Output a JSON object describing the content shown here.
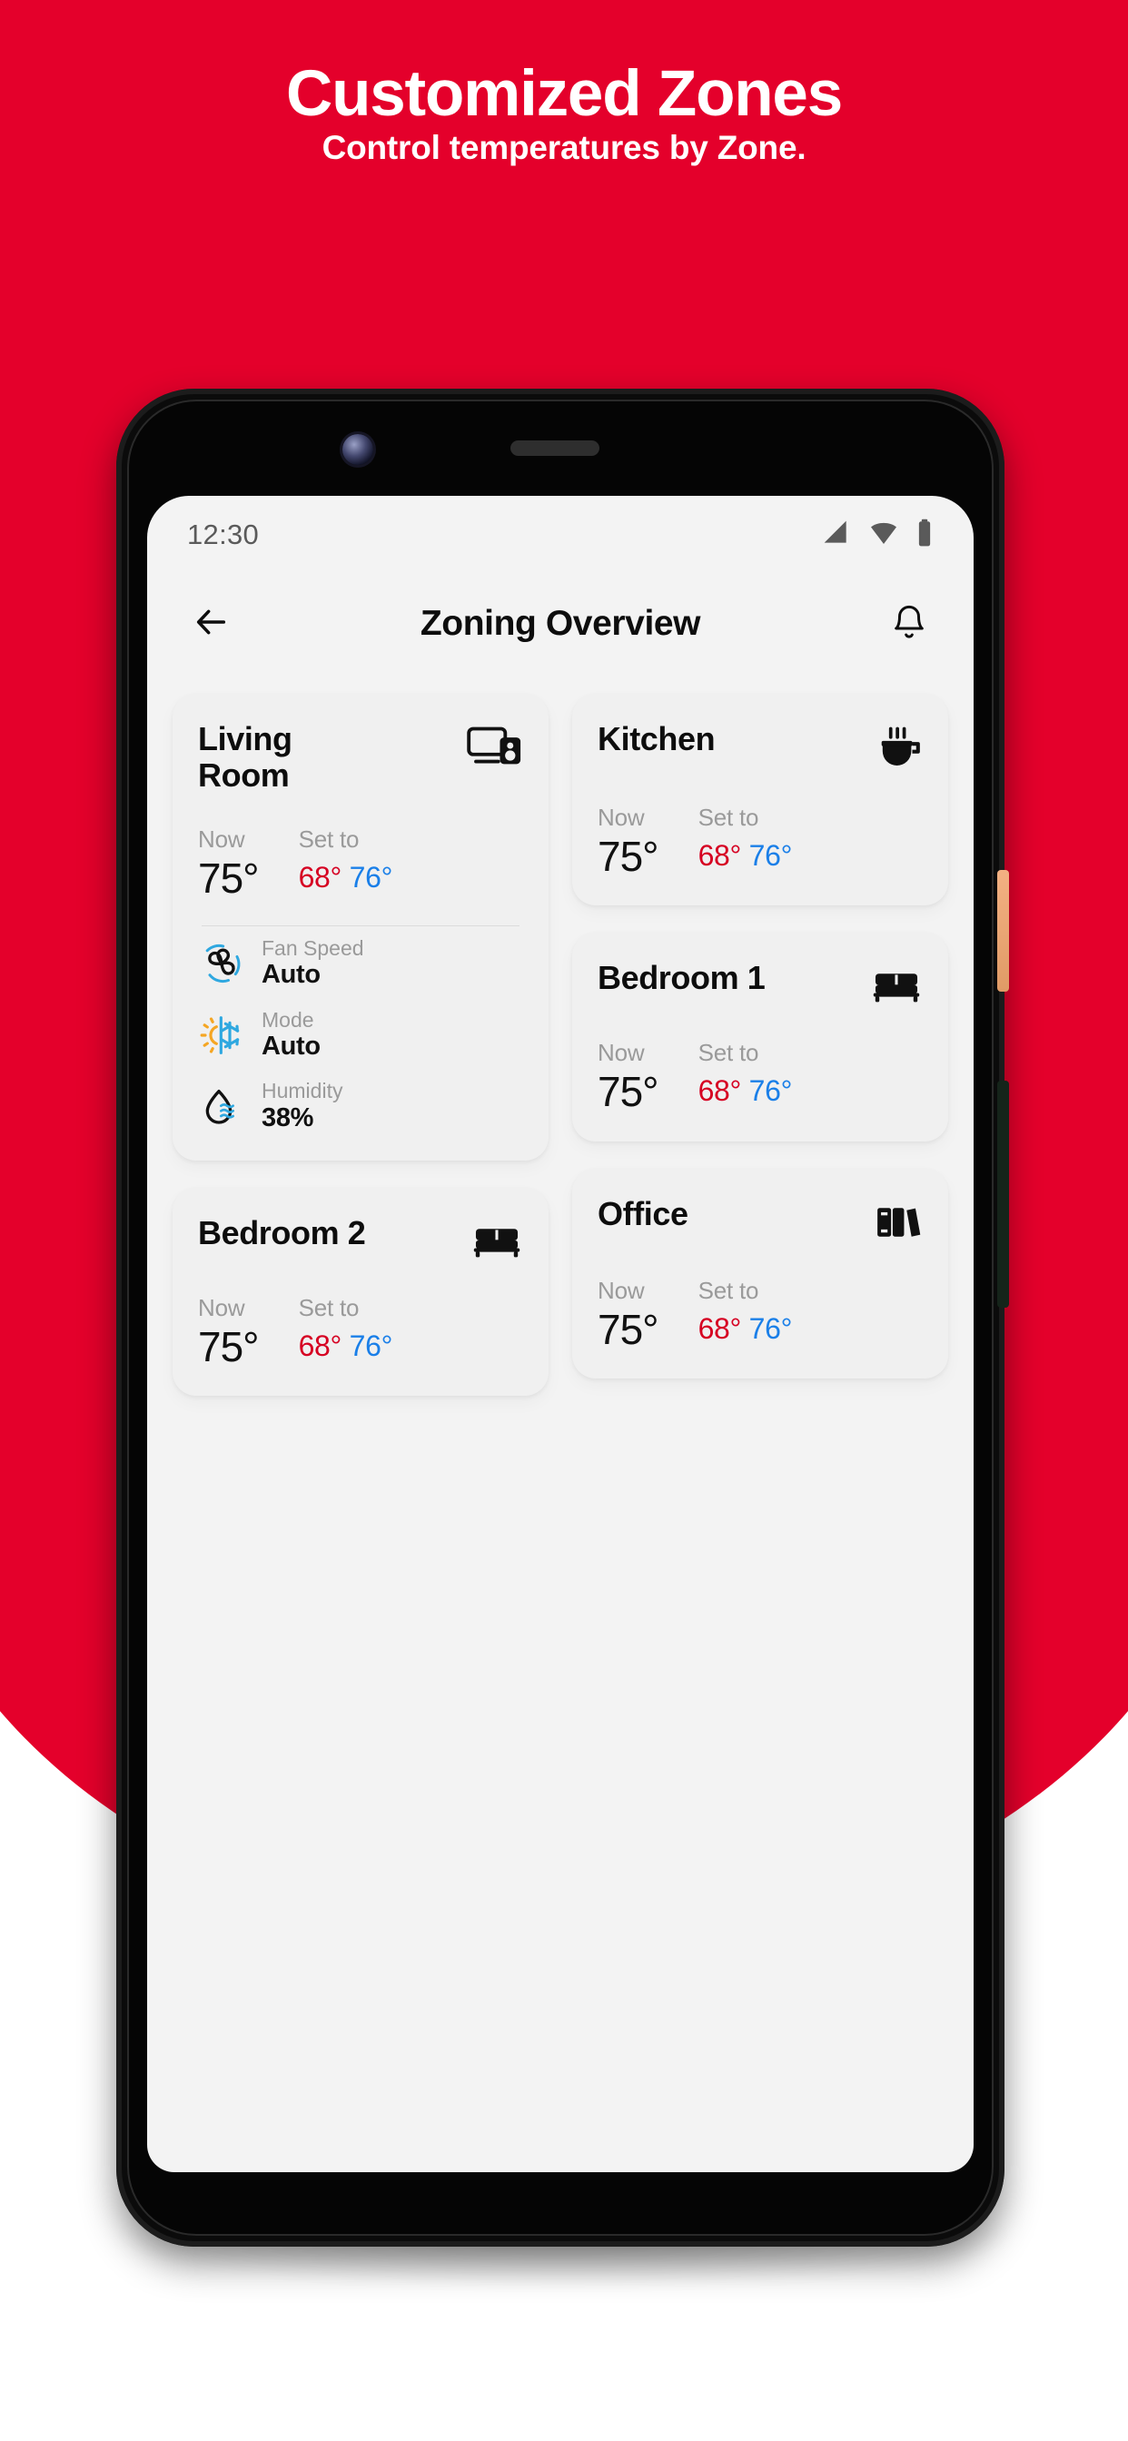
{
  "hero": {
    "title": "Customized Zones",
    "subtitle": "Control temperatures by Zone.",
    "bg_color": "#E4002B"
  },
  "phone": {
    "status_bar": {
      "time": "12:30",
      "icons": [
        "signal-icon",
        "wifi-icon",
        "battery-icon"
      ]
    },
    "app_bar": {
      "back_label": "back-arrow-icon",
      "title": "Zoning Overview",
      "notification_label": "bell-icon"
    }
  },
  "labels": {
    "now": "Now",
    "set_to": "Set to"
  },
  "colors": {
    "accent_red": "#E4002B",
    "temp_low": "#D60022",
    "temp_high": "#1A7FE8",
    "screen_bg": "#f3f3f3",
    "card_bg": "#f0f0f0"
  },
  "zones": [
    {
      "name": "Living Room",
      "icon": "tv-speaker-icon",
      "now": "75°",
      "set_low": "68°",
      "set_high": "76°",
      "details": [
        {
          "icon": "fan-icon",
          "label": "Fan Speed",
          "value": "Auto"
        },
        {
          "icon": "sun-snow-icon",
          "label": "Mode",
          "value": "Auto"
        },
        {
          "icon": "humidity-icon",
          "label": "Humidity",
          "value": "38%"
        }
      ]
    },
    {
      "name": "Kitchen",
      "icon": "coffee-cup-icon",
      "now": "75°",
      "set_low": "68°",
      "set_high": "76°"
    },
    {
      "name": "Bedroom 1",
      "icon": "bed-icon",
      "now": "75°",
      "set_low": "68°",
      "set_high": "76°"
    },
    {
      "name": "Bedroom 2",
      "icon": "bed-icon",
      "now": "75°",
      "set_low": "68°",
      "set_high": "76°"
    },
    {
      "name": "Office",
      "icon": "books-icon",
      "now": "75°",
      "set_low": "68°",
      "set_high": "76°"
    }
  ]
}
